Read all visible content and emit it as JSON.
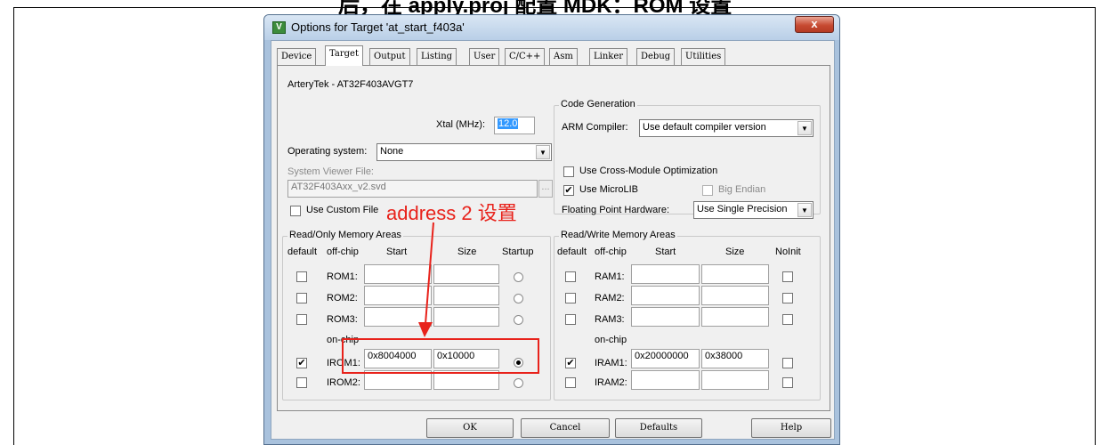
{
  "page": {
    "top_text": "后，在 apply.proj 配置 MDK：ROM 设置"
  },
  "window": {
    "title": "Options for Target 'at_start_f403a'",
    "close_label": "x",
    "app_icon": "keil-uvision-icon"
  },
  "tabs": [
    "Device",
    "Target",
    "Output",
    "Listing",
    "User",
    "C/C++",
    "Asm",
    "Linker",
    "Debug",
    "Utilities"
  ],
  "target": {
    "device_name": "ArteryTek - AT32F403AVGT7",
    "xtal_label": "Xtal (MHz):",
    "xtal_value": "12.0",
    "os_label": "Operating system:",
    "os_value": "None",
    "svf_label": "System Viewer File:",
    "svf_value": "AT32F403Axx_v2.svd",
    "browse_label": "...",
    "custom_file_label": "Use Custom File"
  },
  "code_gen": {
    "title": "Code Generation",
    "compiler_label": "ARM Compiler:",
    "compiler_value": "Use default compiler version",
    "cross_module_label": "Use Cross-Module Optimization",
    "cross_module_checked": false,
    "microlib_label": "Use MicroLIB",
    "microlib_checked": true,
    "big_endian_label": "Big Endian",
    "fp_label": "Floating Point Hardware:",
    "fp_value": "Use Single Precision"
  },
  "ro_memory": {
    "title": "Read/Only Memory Areas",
    "headers": [
      "default",
      "off-chip",
      "Start",
      "Size",
      "Startup"
    ],
    "onchip_label": "on-chip",
    "rows": [
      {
        "label": "ROM1:",
        "default": false,
        "start": "",
        "size": "",
        "startup": false
      },
      {
        "label": "ROM2:",
        "default": false,
        "start": "",
        "size": "",
        "startup": false
      },
      {
        "label": "ROM3:",
        "default": false,
        "start": "",
        "size": "",
        "startup": false
      },
      {
        "label": "IROM1:",
        "default": true,
        "start": "0x8004000",
        "size": "0x10000",
        "startup": true
      },
      {
        "label": "IROM2:",
        "default": false,
        "start": "",
        "size": "",
        "startup": false
      }
    ]
  },
  "rw_memory": {
    "title": "Read/Write Memory Areas",
    "headers": [
      "default",
      "off-chip",
      "Start",
      "Size",
      "NoInit"
    ],
    "onchip_label": "on-chip",
    "rows": [
      {
        "label": "RAM1:",
        "default": false,
        "start": "",
        "size": "",
        "noinit": false
      },
      {
        "label": "RAM2:",
        "default": false,
        "start": "",
        "size": "",
        "noinit": false
      },
      {
        "label": "RAM3:",
        "default": false,
        "start": "",
        "size": "",
        "noinit": false
      },
      {
        "label": "IRAM1:",
        "default": true,
        "start": "0x20000000",
        "size": "0x38000",
        "noinit": false
      },
      {
        "label": "IRAM2:",
        "default": false,
        "start": "",
        "size": "",
        "noinit": false
      }
    ]
  },
  "buttons": {
    "ok": "OK",
    "cancel": "Cancel",
    "defaults": "Defaults",
    "help": "Help"
  },
  "annotation": {
    "text": "address 2 设置",
    "color": "#e8221b"
  }
}
